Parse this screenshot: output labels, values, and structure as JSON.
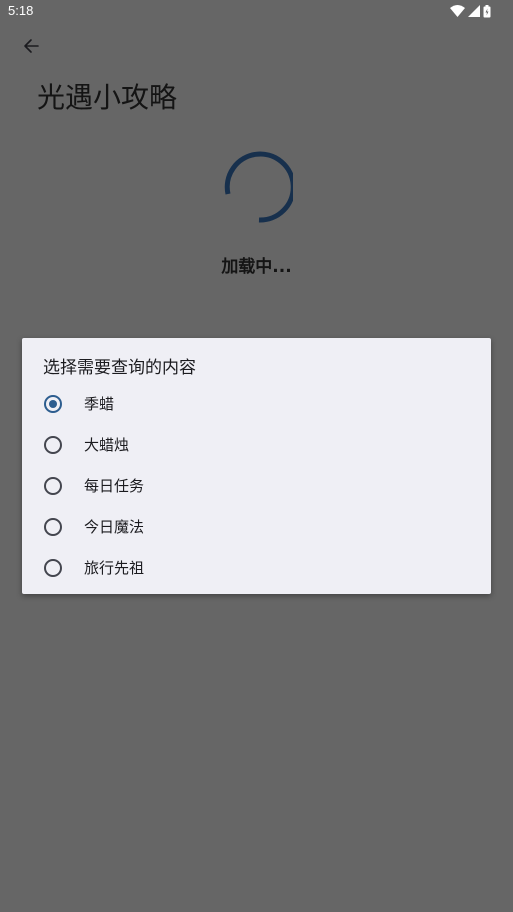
{
  "status_bar": {
    "time": "5:18",
    "icons": [
      "wifi-icon",
      "signal-icon",
      "battery-icon"
    ]
  },
  "app_bar": {
    "back_icon": "arrow-back-icon",
    "title": "光遇小攻略"
  },
  "loading": {
    "text": "加载中..."
  },
  "dialog": {
    "title": "选择需要查询的内容",
    "options": [
      {
        "label": "季蜡",
        "selected": true
      },
      {
        "label": "大蜡烛",
        "selected": false
      },
      {
        "label": "每日任务",
        "selected": false
      },
      {
        "label": "今日魔法",
        "selected": false
      },
      {
        "label": "旅行先祖",
        "selected": false
      }
    ]
  },
  "colors": {
    "scrim_background": "#666666",
    "dialog_background": "#efeff5",
    "accent": "#2d5d8f",
    "spinner": "#17304d"
  }
}
